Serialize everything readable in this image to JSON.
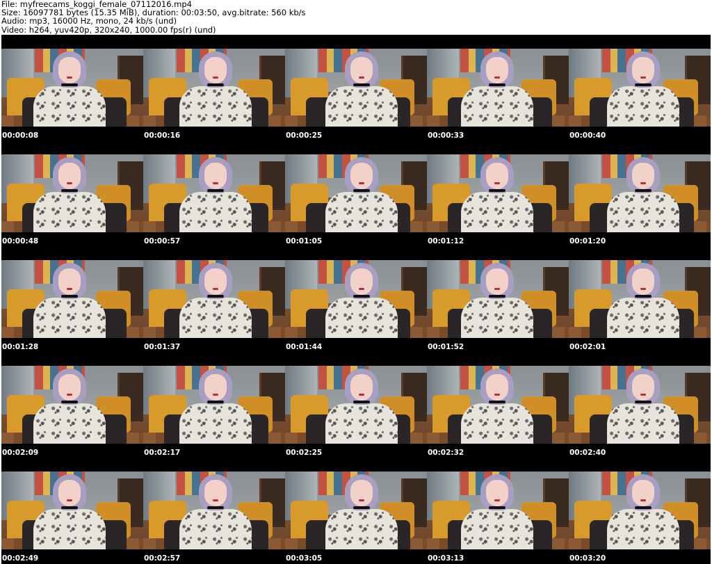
{
  "header": {
    "lines": [
      "File: myfreecams_koggi_female_07112016.mp4",
      "Size: 16097781 bytes (15.35 MiB), duration: 00:03:50, avg.bitrate: 560 kb/s",
      "Audio: mp3, 16000 Hz, mono, 24 kb/s (und)",
      "Video: h264, yuv420p, 320x240, 1000.00 fps(r) (und)"
    ]
  },
  "thumbnails": [
    {
      "time": "00:00:08"
    },
    {
      "time": "00:00:16"
    },
    {
      "time": "00:00:25"
    },
    {
      "time": "00:00:33"
    },
    {
      "time": "00:00:40"
    },
    {
      "time": "00:00:48"
    },
    {
      "time": "00:00:57"
    },
    {
      "time": "00:01:05"
    },
    {
      "time": "00:01:12"
    },
    {
      "time": "00:01:20"
    },
    {
      "time": "00:01:28"
    },
    {
      "time": "00:01:37"
    },
    {
      "time": "00:01:44"
    },
    {
      "time": "00:01:52"
    },
    {
      "time": "00:02:01"
    },
    {
      "time": "00:02:09"
    },
    {
      "time": "00:02:17"
    },
    {
      "time": "00:02:25"
    },
    {
      "time": "00:02:32"
    },
    {
      "time": "00:02:40"
    },
    {
      "time": "00:02:49"
    },
    {
      "time": "00:02:57"
    },
    {
      "time": "00:03:05"
    },
    {
      "time": "00:03:13"
    },
    {
      "time": "00:03:20"
    }
  ],
  "colors": {
    "background": "#000000",
    "timestamp_text": "#ffffff",
    "header_text": "#000000"
  }
}
